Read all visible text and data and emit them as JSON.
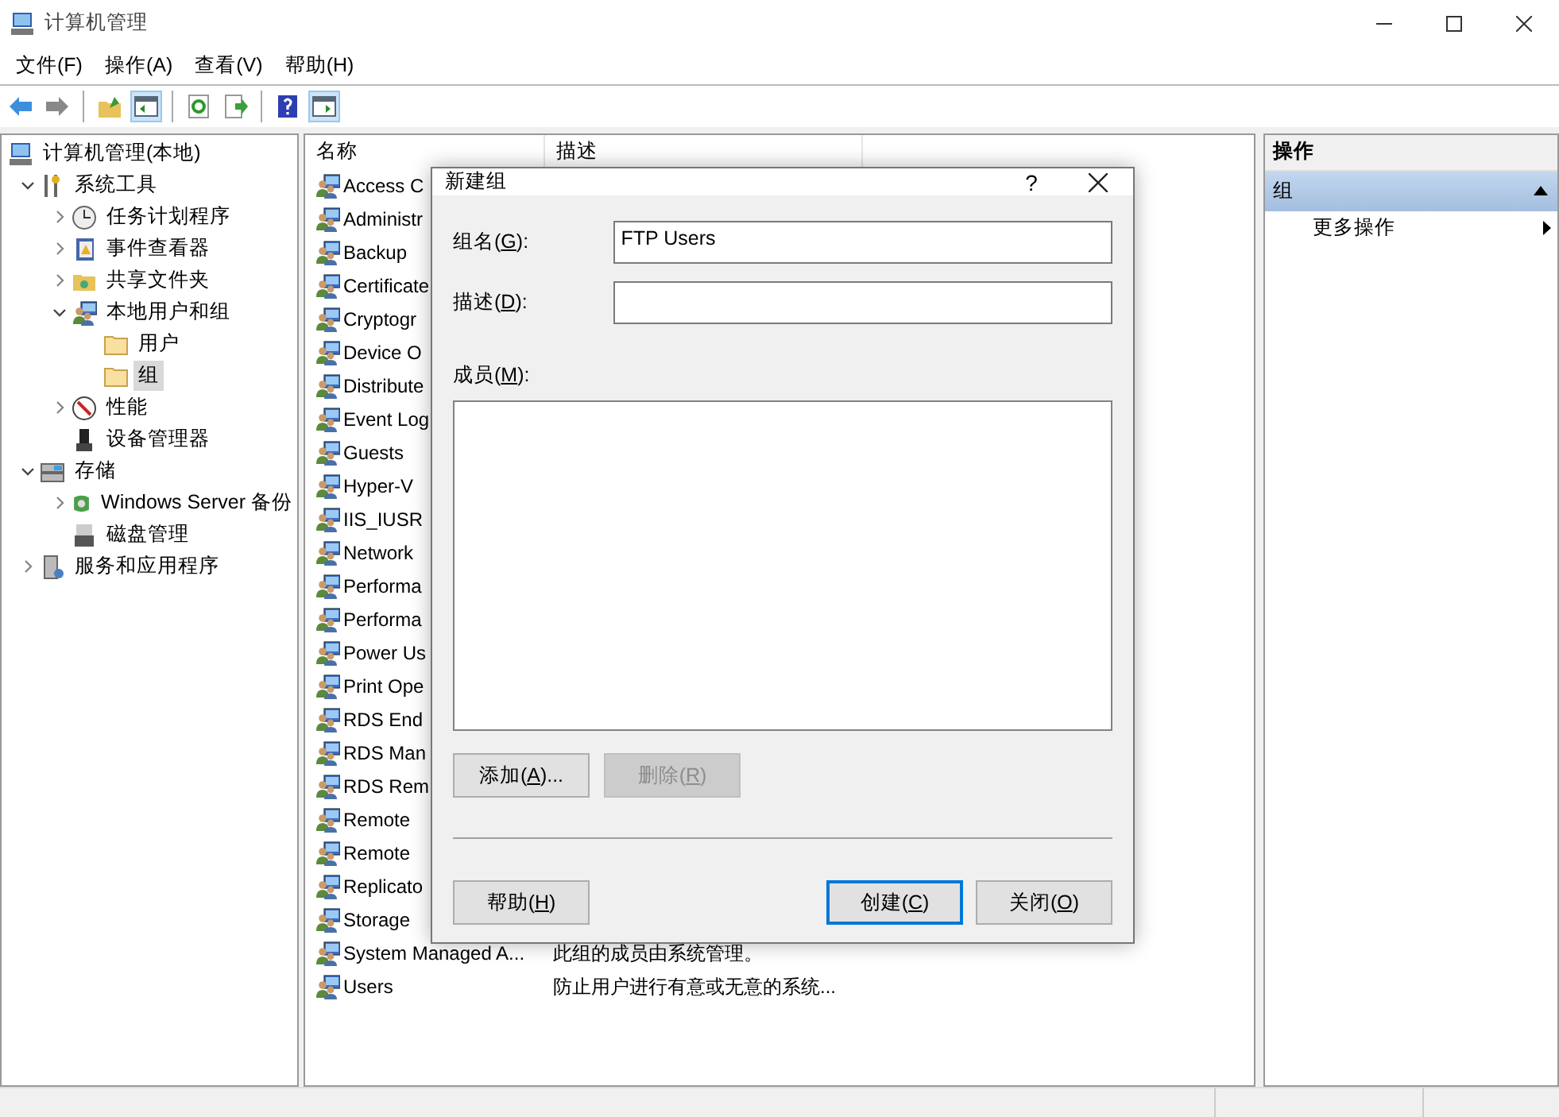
{
  "window": {
    "title": "计算机管理"
  },
  "menu": [
    "文件(F)",
    "操作(A)",
    "查看(V)",
    "帮助(H)"
  ],
  "toolbar": {
    "groups": [
      [
        {
          "selected": false
        },
        {
          "selected": false
        }
      ],
      [
        {
          "selected": false
        },
        {
          "selected": true
        }
      ],
      [
        {
          "selected": false
        },
        {
          "selected": false
        }
      ],
      [
        {
          "selected": false
        },
        {
          "selected": true
        }
      ]
    ]
  },
  "tree": [
    {
      "label": "计算机管理(本地)",
      "selected": false,
      "children": [
        {
          "label": "系统工具",
          "expanded": true,
          "selected": false,
          "children": [
            {
              "label": "任务计划程序",
              "expanded": false,
              "selected": false
            },
            {
              "label": "事件查看器",
              "expanded": false,
              "selected": false
            },
            {
              "label": "共享文件夹",
              "expanded": false,
              "selected": false
            },
            {
              "label": "本地用户和组",
              "expanded": true,
              "selected": false,
              "children": [
                {
                  "label": "用户",
                  "selected": false
                },
                {
                  "label": "组",
                  "selected": true
                }
              ]
            },
            {
              "label": "性能",
              "expanded": false,
              "selected": false
            },
            {
              "label": "设备管理器",
              "selected": false
            }
          ]
        },
        {
          "label": "存储",
          "expanded": true,
          "selected": false,
          "children": [
            {
              "label": "Windows Server 备份",
              "expanded": false,
              "selected": false
            },
            {
              "label": "磁盘管理",
              "selected": false
            }
          ]
        },
        {
          "label": "服务和应用程序",
          "expanded": false,
          "selected": false
        }
      ]
    }
  ],
  "list": {
    "columns": [
      "名称",
      "描述"
    ],
    "rows": [
      {
        "name": "Access C"
      },
      {
        "name": "Administr"
      },
      {
        "name": "Backup"
      },
      {
        "name": "Certificate"
      },
      {
        "name": "Cryptogr"
      },
      {
        "name": "Device O"
      },
      {
        "name": "Distribute"
      },
      {
        "name": "Event Log"
      },
      {
        "name": "Guests"
      },
      {
        "name": "Hyper-V"
      },
      {
        "name": "IIS_IUSR"
      },
      {
        "name": "Network"
      },
      {
        "name": "Performa"
      },
      {
        "name": "Performa"
      },
      {
        "name": "Power Us"
      },
      {
        "name": "Print Ope"
      },
      {
        "name": "RDS End"
      },
      {
        "name": "RDS Man"
      },
      {
        "name": "RDS Rem"
      },
      {
        "name": "Remote"
      },
      {
        "name": "Remote"
      },
      {
        "name": "Replicato"
      },
      {
        "name": "Storage"
      },
      {
        "name": "System Managed A...",
        "description": "此组的成员由系统管理。"
      },
      {
        "name": "Users",
        "description": "防止用户进行有意或无意的系统..."
      }
    ]
  },
  "actions": {
    "header": "操作",
    "sections": [
      {
        "title": "组",
        "expanded": true,
        "items": [
          {
            "label": "更多操作"
          }
        ]
      }
    ]
  },
  "dialog": {
    "title": "新建组",
    "help": "?",
    "fields": [
      {
        "label": [
          "组名(",
          "G",
          "):"
        ],
        "value": "FTP Users"
      },
      {
        "label": [
          "描述(",
          "D",
          "):"
        ]
      }
    ],
    "members_label": [
      "成员(",
      "M",
      "):"
    ],
    "list_buttons": [
      {
        "label": [
          "添加(",
          "A",
          ")..."
        ],
        "disabled": false
      },
      {
        "label": [
          "删除(",
          "R",
          ")"
        ],
        "disabled": true
      }
    ],
    "footer_buttons": [
      {
        "label": [
          "帮助(",
          "H",
          ")"
        ],
        "default": false
      },
      {
        "label": [
          "创建(",
          "C",
          ")"
        ],
        "default": true
      },
      {
        "label": [
          "关闭(",
          "O",
          ")"
        ],
        "default": false
      }
    ]
  }
}
